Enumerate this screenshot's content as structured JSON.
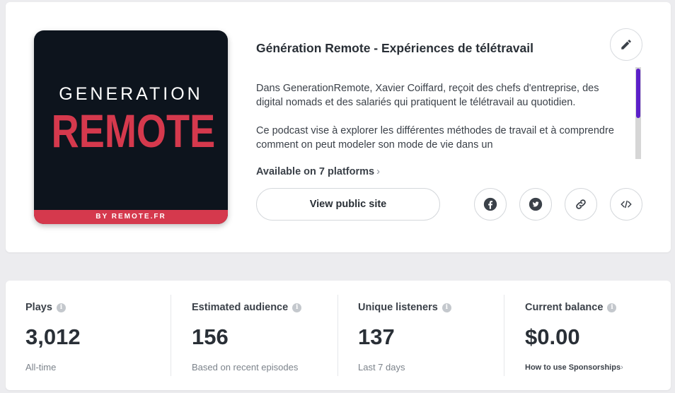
{
  "podcast": {
    "cover": {
      "line1": "GENERATION",
      "line2": "REMOTE",
      "band": "BY REMOTE.FR",
      "background_color": "#0d141d",
      "accent_color": "#d5394d"
    },
    "title": "Génération Remote - Expériences de télétravail",
    "description": [
      "Dans GenerationRemote, Xavier Coiffard, reçoit des chefs d'entreprise, des digital nomads et des salariés qui pratiquent le télétravail au quotidien.",
      "Ce podcast vise à explorer les différentes méthodes de travail et à comprendre comment on peut modeler son mode de vie dans un"
    ],
    "platforms_label": "Available on 7 platforms",
    "view_site_label": "View public site",
    "edit_icon": "pencil-icon",
    "share_icons": [
      "facebook-icon",
      "twitter-icon",
      "link-icon",
      "embed-code-icon"
    ],
    "scrollbar_color": "#5b1fc9"
  },
  "stats": [
    {
      "label": "Plays",
      "value": "3,012",
      "sub": "All-time"
    },
    {
      "label": "Estimated audience",
      "value": "156",
      "sub": "Based on recent episodes"
    },
    {
      "label": "Unique listeners",
      "value": "137",
      "sub": "Last 7 days"
    },
    {
      "label": "Current balance",
      "value": "$0.00",
      "sub": "How to use Sponsorships"
    }
  ]
}
